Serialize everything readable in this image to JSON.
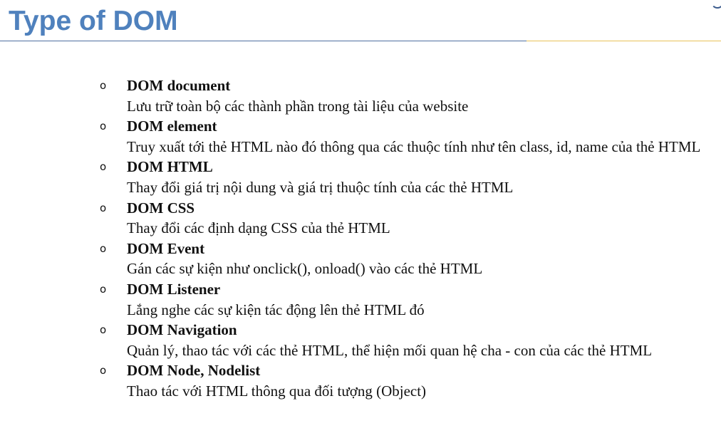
{
  "slide": {
    "title": "Type of DOM",
    "accent_color": "#4f81bd",
    "rule_colors": [
      "#4f6fa0",
      "#e8c25a"
    ]
  },
  "bullet_glyph": "o",
  "items": [
    {
      "title": "DOM document",
      "description": "Lưu trữ toàn bộ các thành phần trong tài liệu của website"
    },
    {
      "title": "DOM element",
      "description": "Truy xuất tới thẻ HTML nào đó thông qua các thuộc tính như tên class, id, name của thẻ HTML"
    },
    {
      "title": "DOM HTML",
      "description": "Thay đổi giá trị nội dung và giá trị thuộc tính của các thẻ HTML"
    },
    {
      "title": "DOM CSS",
      "description": "Thay đổi các định dạng CSS của thẻ HTML"
    },
    {
      "title": "DOM Event",
      "description": "Gán các sự kiện như onclick(), onload() vào các thẻ HTML"
    },
    {
      "title": "DOM Listener",
      "description": "Lắng nghe các sự kiện tác động lên thẻ HTML đó"
    },
    {
      "title": "DOM Navigation",
      "description": "Quản lý, thao tác với các thẻ HTML, thể hiện mối quan hệ cha - con của các thẻ HTML"
    },
    {
      "title": "DOM Node, Nodelist",
      "description": "Thao tác với HTML thông qua đối tượng (Object)"
    }
  ]
}
